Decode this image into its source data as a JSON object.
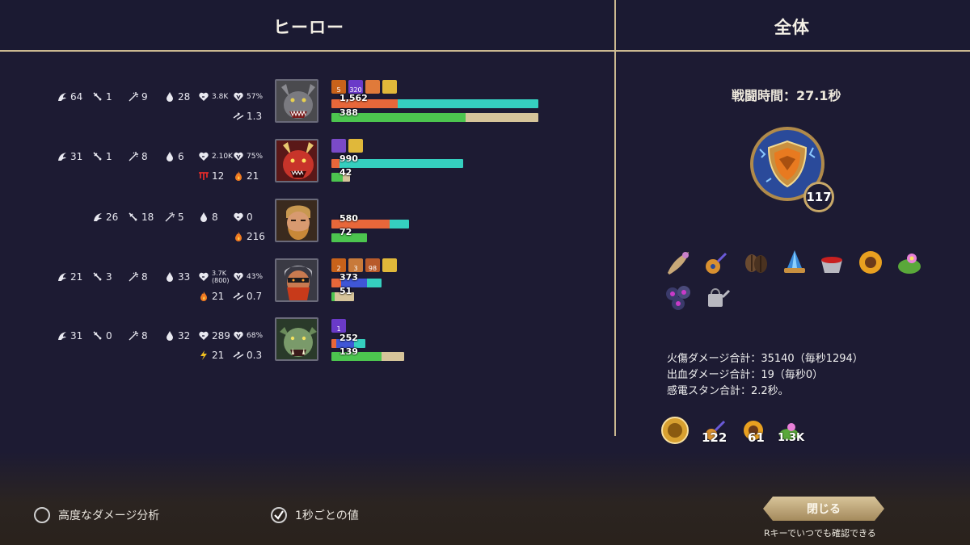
{
  "header": {
    "heroes_title": "ヒーロー",
    "overall_title": "全体"
  },
  "heroes": [
    {
      "name": "werewolf",
      "stats": {
        "kills": "64",
        "stat2": "1",
        "stat3": "9",
        "stat4": "28",
        "hp": "3.8K",
        "hp_pct": "57%",
        "extra1": "1.3"
      },
      "buffs": [
        "5",
        "320",
        "",
        ""
      ],
      "damage_label": "1,562",
      "damage_fraction": 1.0,
      "heal_label": "388",
      "heal_fraction": 1.0
    },
    {
      "name": "red-dragon",
      "stats": {
        "kills": "31",
        "stat2": "1",
        "stat3": "8",
        "stat4": "6",
        "hp": "2.10K",
        "hp_pct": "75%",
        "bleed": "12",
        "fire": "21"
      },
      "buffs": [
        "",
        ""
      ],
      "damage_label": "990",
      "damage_fraction": 0.63,
      "heal_label": "42",
      "heal_fraction": 0.09
    },
    {
      "name": "bearded-warrior",
      "stats": {
        "kills": "26",
        "stat2": "18",
        "stat3": "5",
        "stat4": "8",
        "hp": "0",
        "fire": "216"
      },
      "buffs": [],
      "damage_label": "580",
      "damage_fraction": 0.37,
      "heal_label": "72",
      "heal_fraction": 0.17
    },
    {
      "name": "masked-rogue",
      "stats": {
        "kills": "21",
        "stat2": "3",
        "stat3": "8",
        "stat4": "33",
        "hp": "3.7K",
        "hp_sub": "(800)",
        "hp_pct": "43%",
        "fire": "21",
        "extra1": "0.7"
      },
      "buffs": [
        "2",
        "3",
        "98",
        ""
      ],
      "damage_label": "373",
      "damage_fraction": 0.24,
      "heal_label": "51",
      "heal_fraction": 0.12
    },
    {
      "name": "orc-brute",
      "stats": {
        "kills": "31",
        "stat2": "0",
        "stat3": "8",
        "stat4": "32",
        "hp": "289",
        "hp_pct": "68%",
        "shock": "21",
        "extra1": "0.3"
      },
      "buffs": [
        "1"
      ],
      "damage_label": "252",
      "damage_fraction": 0.16,
      "heal_label": "139",
      "heal_fraction": 0.35
    }
  ],
  "overall": {
    "battle_time": "戦闘時間：27.1秒",
    "shield_level": "117",
    "summary": [
      "火傷ダメージ合計：35140（毎秒1294）",
      "出血ダメージ合計：19（毎秒0）",
      "感電スタン合計：2.2秒。"
    ],
    "mini_values": [
      "122",
      "61",
      "1.3K"
    ]
  },
  "footer": {
    "advanced_analysis": "高度なダメージ分析",
    "per_second": "1秒ごとの値",
    "close_label": "閉じる",
    "hint": "Rキーでいつでも確認できる"
  },
  "colors": {
    "gold": "#cbb991",
    "damage_orange": "#e8673a",
    "damage_teal": "#35cfbf",
    "heal_green": "#4cc54f",
    "heal_tan": "#d6c49a",
    "blue": "#3f56d6"
  }
}
